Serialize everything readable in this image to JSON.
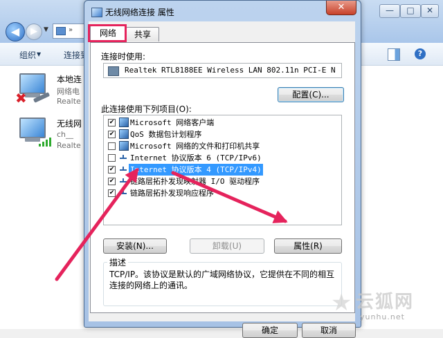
{
  "background": {
    "toolbar": {
      "organize": "组织",
      "connect": "连接到"
    },
    "items": [
      {
        "name": "本地连",
        "sub1": "网络电",
        "sub2": "Realte"
      },
      {
        "name": "无线网",
        "sub1": "ch__",
        "sub2": "Realte"
      }
    ]
  },
  "dialog": {
    "title": "无线网络连接 属性",
    "close": "✕",
    "tabs": [
      {
        "label": "网络"
      },
      {
        "label": "共享"
      }
    ],
    "connect_using_label": "连接时使用:",
    "adapter": "Realtek RTL8188EE Wireless LAN 802.11n PCI-E N",
    "configure_button": "配置(C)...",
    "items_label": "此连接使用下列项目(O):",
    "items": [
      {
        "checked": true,
        "icon": "network-client",
        "label": "Microsoft 网络客户端"
      },
      {
        "checked": true,
        "icon": "network-service",
        "label": "QoS 数据包计划程序"
      },
      {
        "checked": false,
        "icon": "network-service",
        "label": "Microsoft 网络的文件和打印机共享"
      },
      {
        "checked": false,
        "icon": "protocol",
        "label": "Internet 协议版本 6 (TCP/IPv6)"
      },
      {
        "checked": true,
        "icon": "protocol",
        "label": "Internet 协议版本 4 (TCP/IPv4)",
        "selected": true
      },
      {
        "checked": true,
        "icon": "protocol",
        "label": "链路层拓扑发现映射器 I/O 驱动程序"
      },
      {
        "checked": true,
        "icon": "protocol",
        "label": "链路层拓扑发现响应程序"
      }
    ],
    "install_button": "安装(N)...",
    "uninstall_button": "卸载(U)",
    "properties_button": "属性(R)",
    "description_title": "描述",
    "description": "TCP/IP。该协议是默认的广域网络协议，它提供在不同的相互连接的网络上的通讯。",
    "ok_button": "确定",
    "cancel_button": "取消"
  },
  "watermark": {
    "cn": "云狐网",
    "en": "yunhu.net"
  },
  "colors": {
    "highlight": "#e5235c",
    "selection": "#3399ff"
  }
}
